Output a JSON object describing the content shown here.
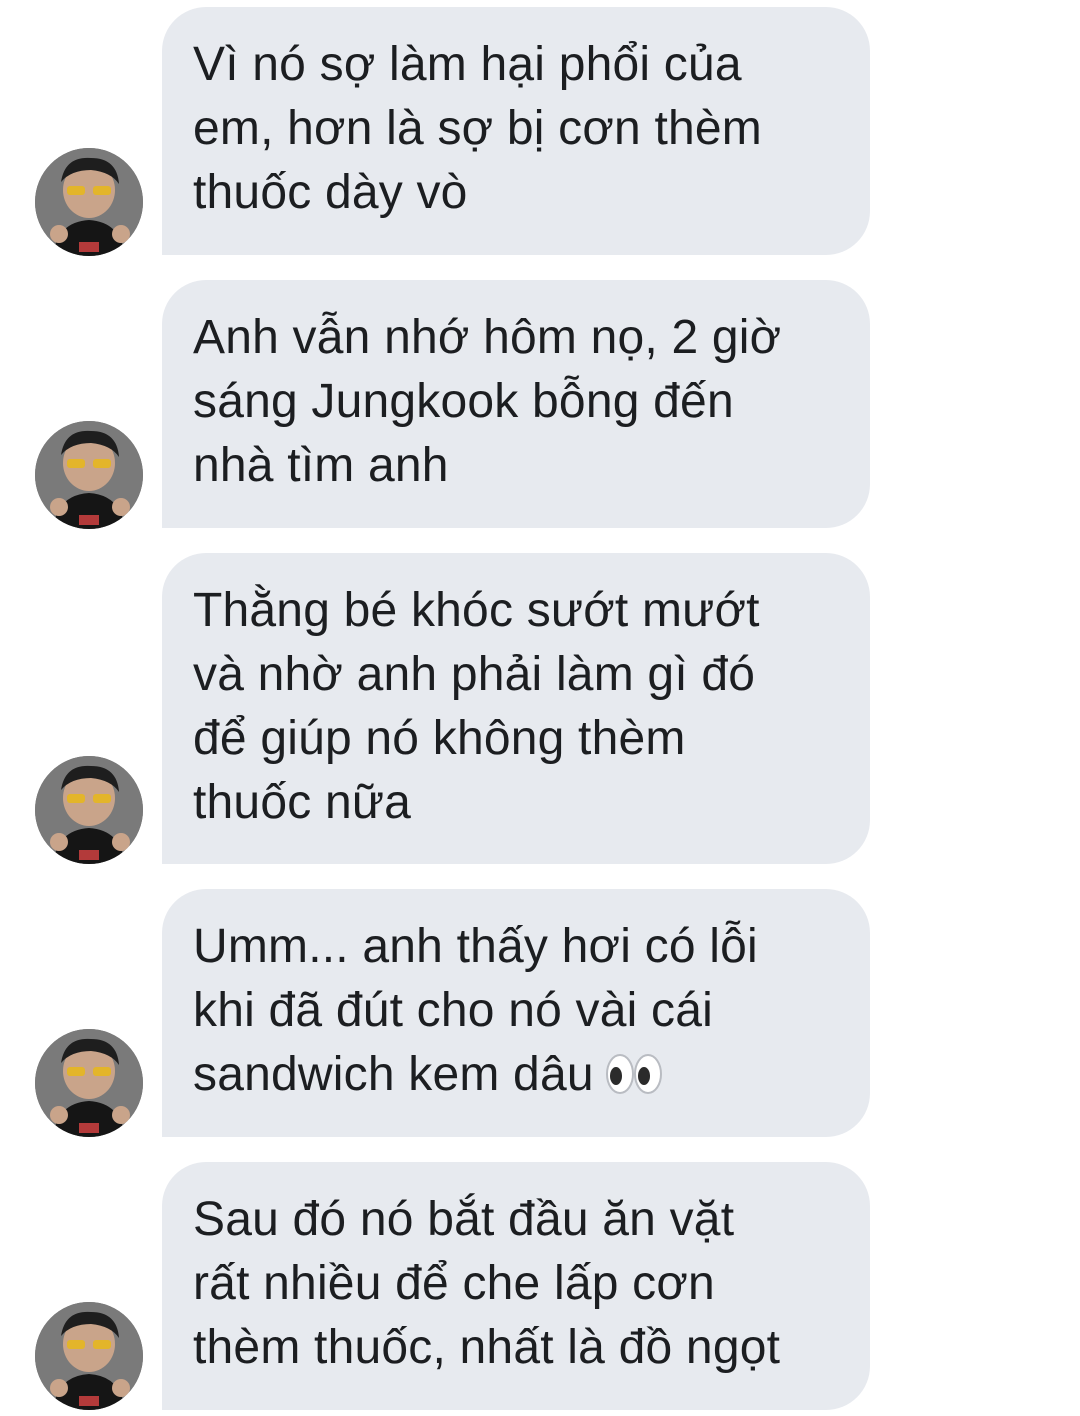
{
  "thread": {
    "messages": [
      {
        "lines": [
          "Vì nó sợ làm hại phổi của",
          "em, hơn là sợ bị cơn thèm",
          "thuốc dày vò"
        ]
      },
      {
        "lines": [
          "Anh vẫn nhớ hôm nọ, 2 giờ",
          "sáng Jungkook bỗng đến",
          "nhà tìm anh"
        ]
      },
      {
        "lines": [
          "Thằng bé khóc sướt mướt",
          "và nhờ anh phải làm gì đó",
          "để giúp nó không thèm",
          "thuốc nữa"
        ]
      },
      {
        "lines": [
          "Umm... anh thấy hơi có lỗi",
          "khi đã đút cho nó vài cái",
          "sandwich kem dâu"
        ],
        "trailing_emoji": "eyes-emoji"
      },
      {
        "lines": [
          "Sau đó nó bắt đầu ăn vặt",
          "rất nhiều để che lấp cơn",
          "thèm thuốc, nhất là đồ ngọt"
        ]
      }
    ]
  },
  "colors": {
    "bubble_background": "#e7eaef",
    "message_text": "#1c1e21",
    "page_background": "#ffffff"
  }
}
